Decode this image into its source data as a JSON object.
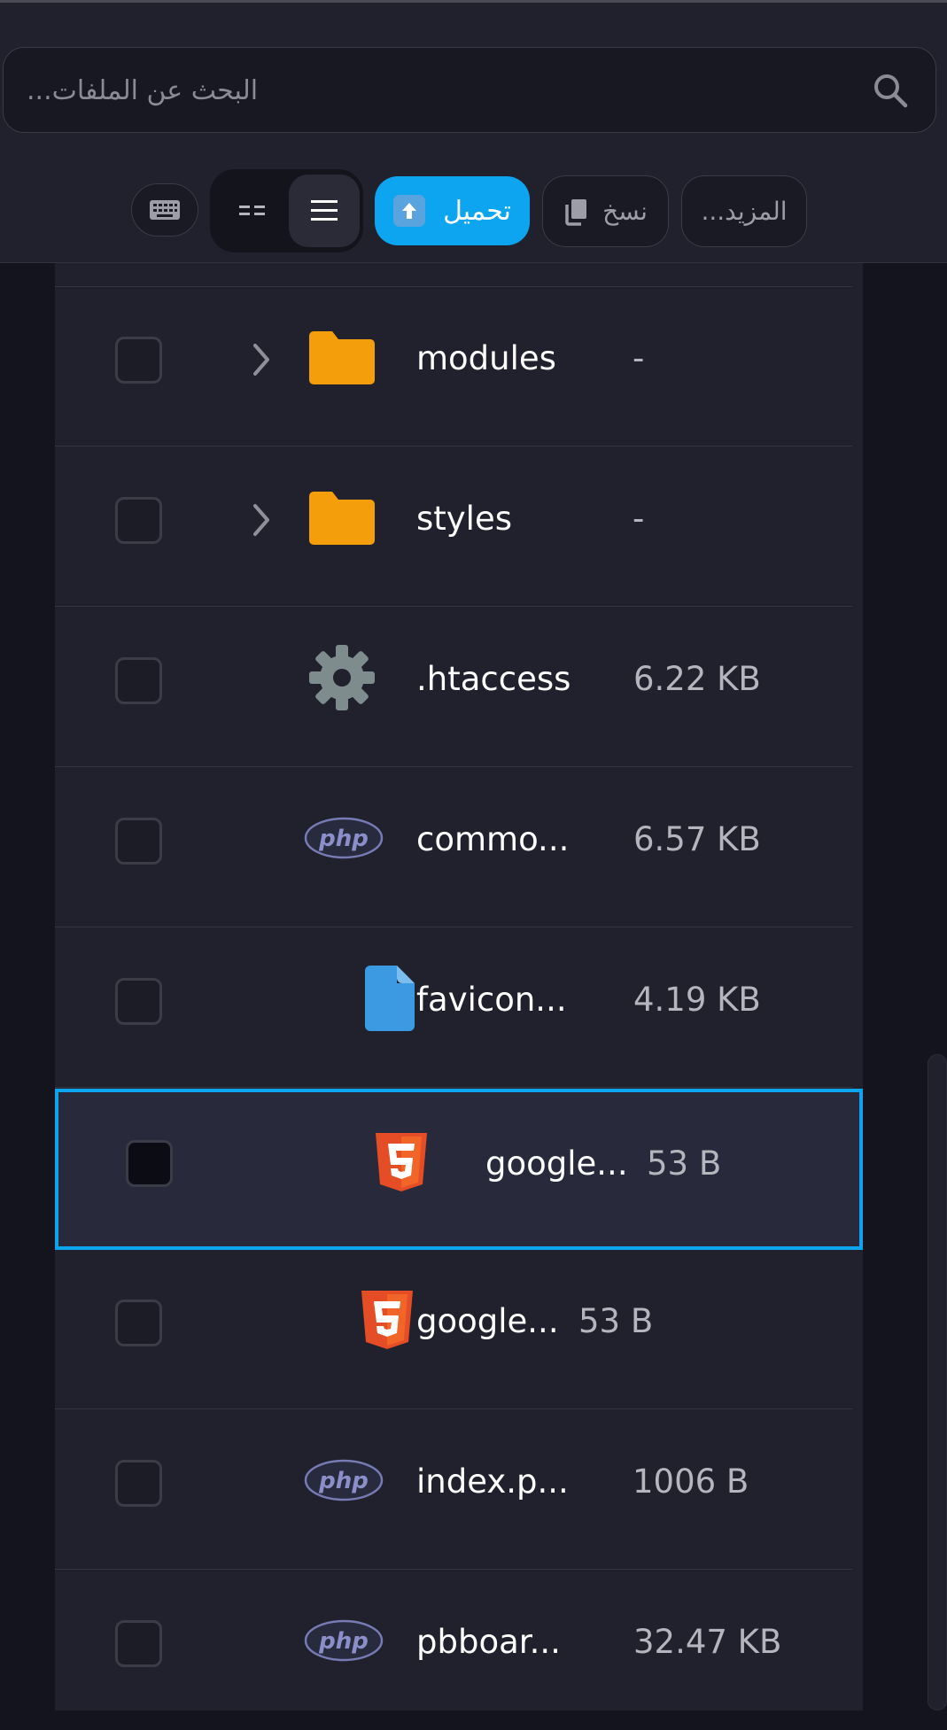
{
  "search": {
    "placeholder": "البحث عن الملفات..."
  },
  "toolbar": {
    "upload_label": "تحميل",
    "copy_label": "نسخ",
    "more_label": "المزيد..."
  },
  "files": [
    {
      "name": "modules",
      "size": "-",
      "type": "folder",
      "icon": "folder-icon"
    },
    {
      "name": "styles",
      "size": "-",
      "type": "folder",
      "icon": "folder-icon"
    },
    {
      "name": ".htaccess",
      "size": "6.22 KB",
      "type": "config",
      "icon": "gear-icon"
    },
    {
      "name": "commo...",
      "size": "6.57 KB",
      "type": "php",
      "icon": "php-icon"
    },
    {
      "name": "favicon...",
      "size": "4.19 KB",
      "type": "file",
      "icon": "file-icon"
    },
    {
      "name": "google...",
      "size": "53 B",
      "type": "html",
      "icon": "html5-icon",
      "selected": true
    },
    {
      "name": "google...",
      "size": "53 B",
      "type": "html",
      "icon": "html5-icon"
    },
    {
      "name": "index.p...",
      "size": "1006 B",
      "type": "php",
      "icon": "php-icon"
    },
    {
      "name": "pbboar...",
      "size": "32.47 KB",
      "type": "php",
      "icon": "php-icon"
    }
  ],
  "colors": {
    "accent": "#0ea5f0",
    "folder": "#f59e0b",
    "html5": "#e44d26",
    "php": "#777bb4",
    "file": "#3b9ae1",
    "gear": "#7f8c8d"
  }
}
